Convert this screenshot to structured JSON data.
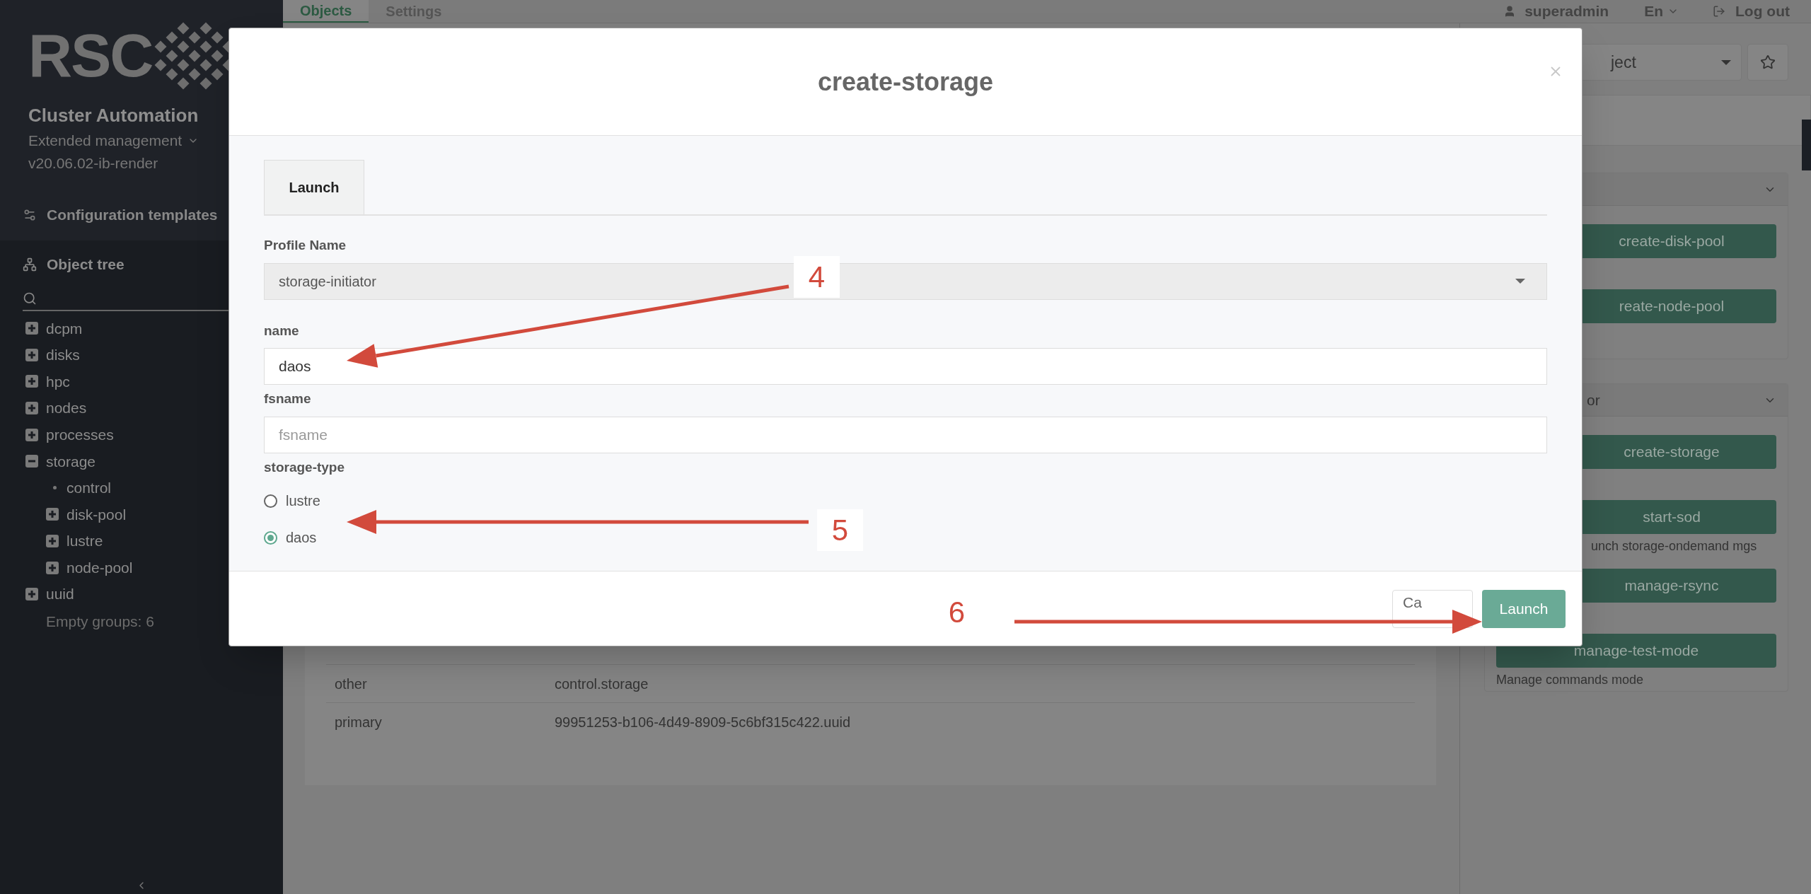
{
  "sidebar": {
    "logo_text": "RSC",
    "app_title": "Cluster Automation",
    "mode": "Extended management",
    "version": "v20.06.02-ib-render",
    "config_link": "Configuration templates",
    "tree_title": "Object tree",
    "tree": [
      {
        "label": "dcpm",
        "expanded": false
      },
      {
        "label": "disks",
        "expanded": false
      },
      {
        "label": "hpc",
        "expanded": false
      },
      {
        "label": "nodes",
        "expanded": false
      },
      {
        "label": "processes",
        "expanded": false
      },
      {
        "label": "storage",
        "expanded": true,
        "children": [
          {
            "label": "control"
          },
          {
            "label": "disk-pool",
            "expanded": false
          },
          {
            "label": "lustre",
            "expanded": false
          },
          {
            "label": "node-pool",
            "expanded": false
          }
        ]
      },
      {
        "label": "uuid",
        "expanded": false
      }
    ],
    "empty_groups": "Empty groups: 6"
  },
  "top_nav": {
    "tabs": [
      {
        "label": "Objects",
        "selected": true
      },
      {
        "label": "Settings",
        "selected": false
      }
    ],
    "user": "superadmin",
    "language": "En",
    "logout": "Log out"
  },
  "table": {
    "rows": [
      {
        "key": "other",
        "value": "control.storage"
      },
      {
        "key": "primary",
        "value": "99951253-b106-4d49-8909-5c6bf315c422.uuid"
      }
    ]
  },
  "right_panel": {
    "object_select": "ject",
    "cards": [
      {
        "actions": [
          {
            "label": "create-disk-pool"
          },
          {
            "label": "reate-node-pool"
          }
        ]
      },
      {
        "title": "or",
        "actions": [
          {
            "label": "create-storage"
          },
          {
            "label": "start-sod",
            "description": "unch storage-ondemand mgs"
          },
          {
            "label": "manage-rsync"
          },
          {
            "label": "manage-test-mode",
            "description": "Manage commands mode"
          }
        ]
      }
    ]
  },
  "modal": {
    "title": "create-storage",
    "tabs": [
      {
        "label": "Launch",
        "selected": true
      }
    ],
    "fields": [
      {
        "kind": "select",
        "label": "Profile Name",
        "value": "storage-initiator"
      },
      {
        "kind": "text",
        "label": "name",
        "value": "daos"
      },
      {
        "kind": "text",
        "label": "fsname",
        "placeholder": "fsname"
      },
      {
        "kind": "radio",
        "label": "storage-type",
        "options": [
          {
            "label": "lustre",
            "selected": false
          },
          {
            "label": "daos",
            "selected": true
          }
        ]
      }
    ],
    "buttons": [
      {
        "kind": "secondary",
        "label": "Ca"
      },
      {
        "kind": "primary",
        "label": "Launch"
      }
    ]
  },
  "annotations": [
    {
      "label": "4"
    },
    {
      "label": "5"
    },
    {
      "label": "6"
    }
  ]
}
